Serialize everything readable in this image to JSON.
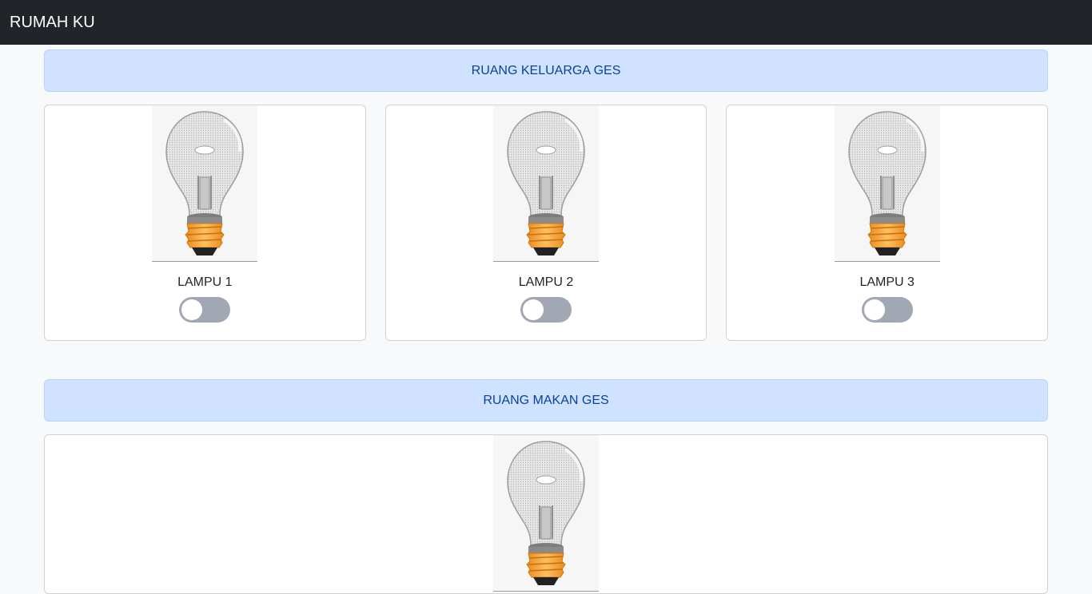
{
  "app": {
    "title": "RUMAH KU"
  },
  "rooms": [
    {
      "name": "RUANG KELUARGA GES",
      "lamps": [
        {
          "label": "LAMPU 1",
          "on": false
        },
        {
          "label": "LAMPU 2",
          "on": false
        },
        {
          "label": "LAMPU 3",
          "on": false
        }
      ]
    },
    {
      "name": "RUANG MAKAN GES",
      "lamps": [
        {
          "label": "",
          "on": false
        }
      ]
    }
  ],
  "icons": {
    "bulb": "light-bulb-icon",
    "toggle": "switch-toggle"
  },
  "colors": {
    "navbar_bg": "#212529",
    "room_header_bg": "#cfe2ff",
    "room_header_text": "#084298",
    "toggle_off": "#a1a8b3",
    "bulb_base": "#f7a23a"
  }
}
